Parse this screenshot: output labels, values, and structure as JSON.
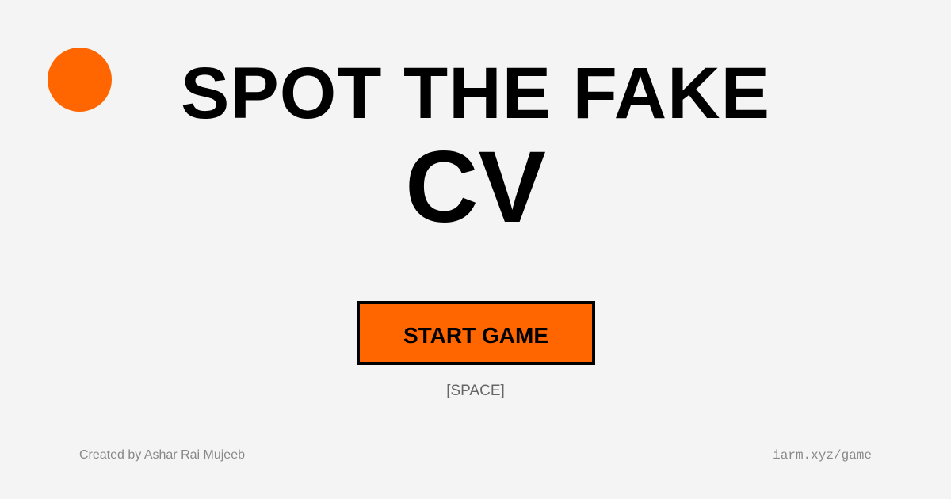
{
  "title": {
    "line1": "SPOT THE FAKE",
    "line2": "CV"
  },
  "start": {
    "label": "START GAME",
    "key_hint": "[SPACE]"
  },
  "footer": {
    "credit": "Created by Ashar Rai Mujeeb",
    "url": "iarm.xyz/game"
  },
  "colors": {
    "accent": "#ff6600",
    "background": "#f4f4f4",
    "text": "#000000"
  }
}
